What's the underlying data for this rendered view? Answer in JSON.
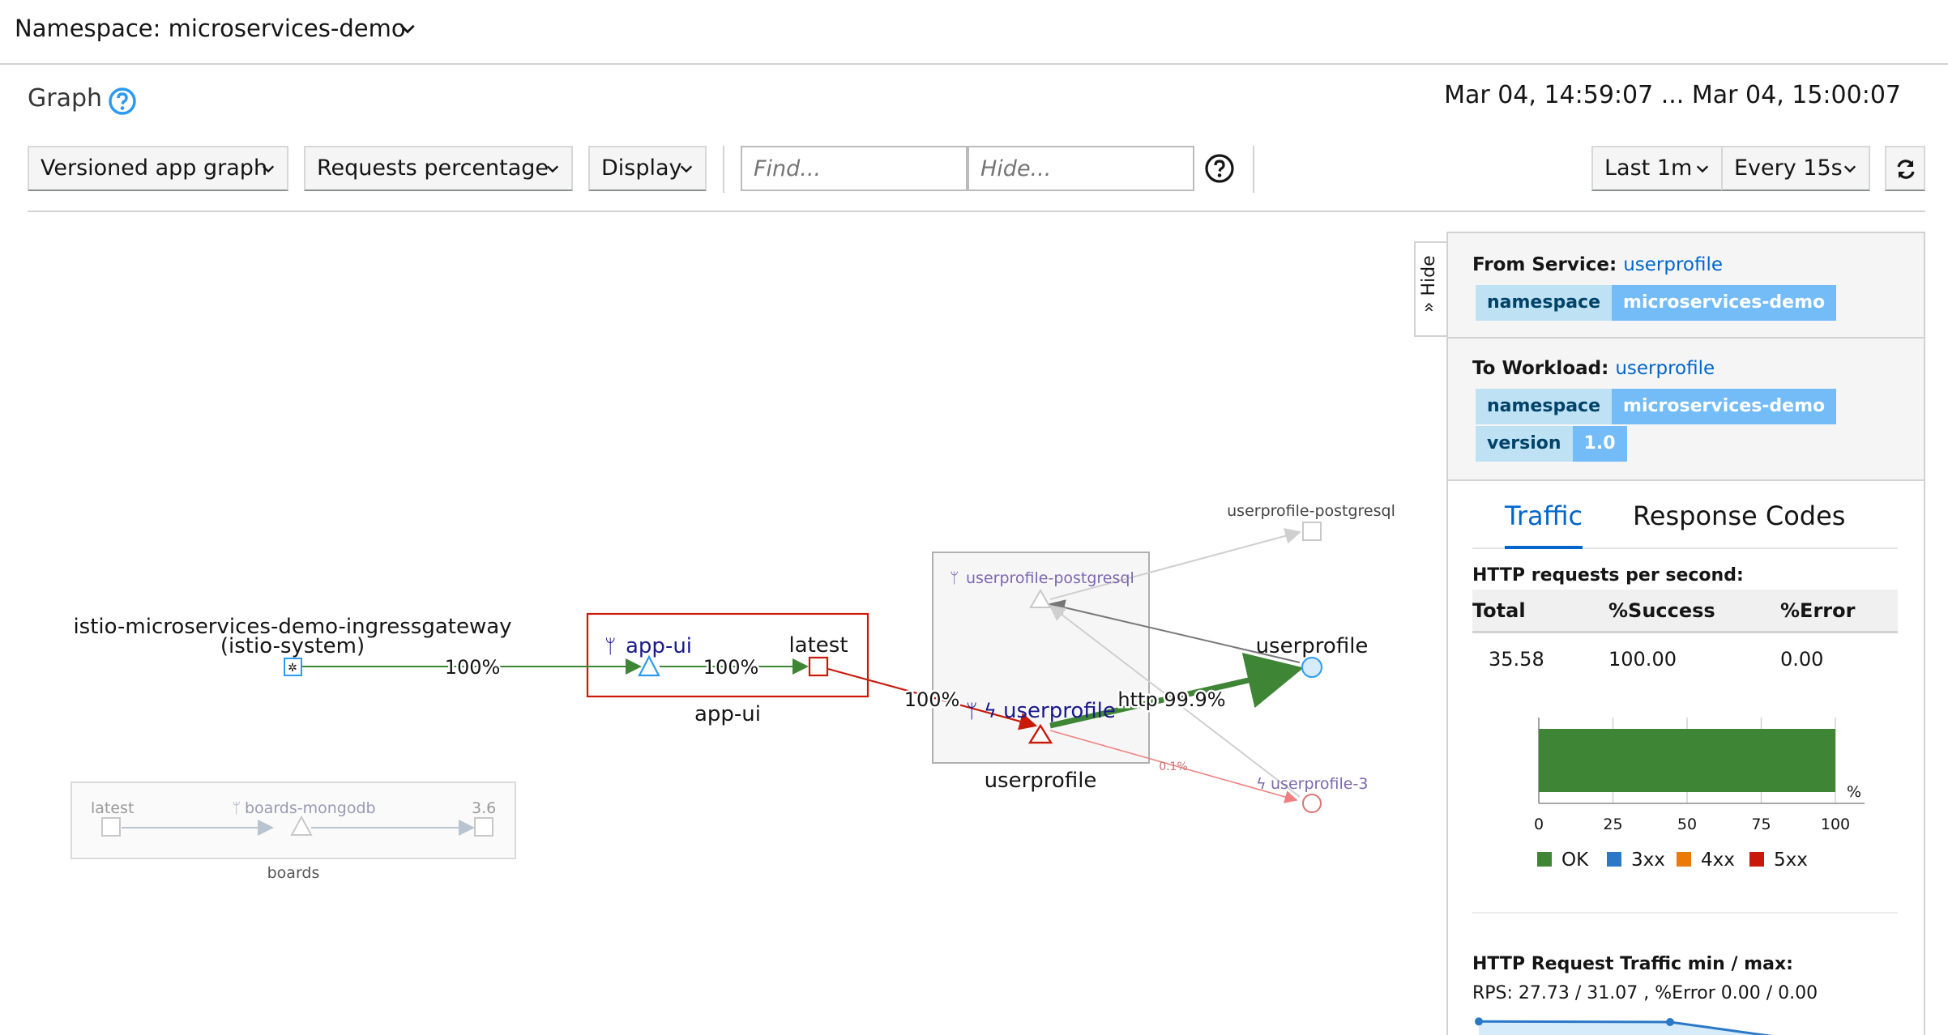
{
  "namespace": {
    "label": "Namespace: microservices-demo"
  },
  "graph": {
    "title": "Graph",
    "time_range": "Mar 04, 14:59:07 ... Mar 04, 15:00:07",
    "toolbar": {
      "graph_type": "Versioned app graph",
      "edge_labels": "Requests percentage",
      "display": "Display",
      "find_placeholder": "Find...",
      "hide_placeholder": "Hide...",
      "duration": "Last 1m",
      "refresh_interval": "Every 15s"
    },
    "nodes": {
      "ingress_name": "istio-microservices-demo-ingressgateway",
      "ingress_ns": "(istio-system)",
      "appui_app": "app-ui",
      "appui_version": "latest",
      "appui_box": "app-ui",
      "up_service": "userprofile",
      "up_postgres_inner": "userprofile-postgresql",
      "up_box": "userprofile",
      "up_workload": "userprofile",
      "up_postgres_outer": "userprofile-postgresql",
      "up3": "userprofile-3",
      "boards_latest": "latest",
      "boards_mongodb": "boards-mongodb",
      "boards_version": "3.6",
      "boards_box": "boards"
    },
    "edges": {
      "ingress_to_appui": "100%",
      "appui_to_latest": "100%",
      "latest_to_userprofile": "100%",
      "userprofile_to_workload": "http 99.9%",
      "userprofile_to_up3": "0.1%"
    },
    "colors": {
      "ok": "#3e8635",
      "error": "#c9190b",
      "accent": "#0066cc"
    }
  },
  "side_panel": {
    "hide_label": "» Hide",
    "from_service": {
      "label": "From Service:",
      "link": "userprofile",
      "badges": [
        {
          "key": "namespace",
          "value": "microservices-demo"
        }
      ]
    },
    "to_workload": {
      "label": "To Workload:",
      "link": "userprofile",
      "badges": [
        {
          "key": "namespace",
          "value": "microservices-demo"
        },
        {
          "key": "version",
          "value": "1.0"
        }
      ]
    },
    "tabs": {
      "traffic": "Traffic",
      "response_codes": "Response Codes"
    },
    "rps": {
      "title": "HTTP requests per second:",
      "headers": {
        "total": "Total",
        "success": "%Success",
        "error": "%Error"
      },
      "values": {
        "total": "35.58",
        "success": "100.00",
        "error": "0.00"
      }
    },
    "min_max": {
      "title": "HTTP Request Traffic min / max:",
      "values": "RPS: 27.73 / 31.07 , %Error 0.00 / 0.00"
    }
  },
  "chart_data": {
    "type": "bar",
    "orientation": "horizontal",
    "unit": "%",
    "xlim": [
      0,
      100
    ],
    "ticks": [
      "0",
      "25",
      "50",
      "75",
      "100"
    ],
    "series": [
      {
        "name": "OK",
        "color": "#3e8635",
        "value": 100
      },
      {
        "name": "3xx",
        "color": "#2b78c6",
        "value": 0
      },
      {
        "name": "4xx",
        "color": "#ec7a08",
        "value": 0
      },
      {
        "name": "5xx",
        "color": "#c9190b",
        "value": 0
      }
    ],
    "sparkline": {
      "y": [
        31.07,
        31.0,
        27.73
      ]
    }
  }
}
